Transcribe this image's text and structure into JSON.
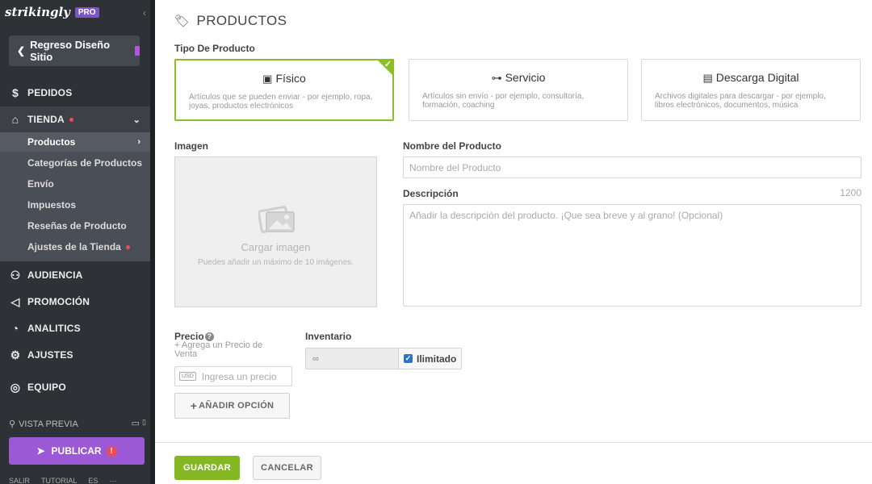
{
  "sidebar": {
    "logo": "strikingly",
    "badge": "PRO",
    "back_label": "Regreso Diseño Sitio",
    "nav": {
      "pedidos": "PEDIDOS",
      "tienda": "TIENDA",
      "audiencia": "AUDIENCIA",
      "promocion": "PROMOCIÓN",
      "analitics": "ANALITICS",
      "ajustes": "AJUSTES",
      "equipo": "EQUIPO"
    },
    "submenu": [
      "Productos",
      "Categorías de Productos",
      "Envío",
      "Impuestos",
      "Reseñas de Producto",
      "Ajustes de la Tienda"
    ],
    "preview_label": "VISTA PREVIA",
    "publish_label": "PUBLICAR",
    "footer_links": [
      "SALIR",
      "TUTORIAL",
      "ES",
      "···"
    ]
  },
  "main": {
    "title": "PRODUCTOS",
    "product_type_label": "Tipo De Producto",
    "product_types": [
      {
        "title": "Físico",
        "description": "Artículos que se pueden enviar - por ejemplo, ropa, joyas, productos electrónicos",
        "selected": true
      },
      {
        "title": "Servicio",
        "description": "Artículos sin envío - por ejemplo, consultoría, formación, coaching",
        "selected": false
      },
      {
        "title": "Descarga Digital",
        "description": "Archivos digitales para descargar - por ejemplo, libros electrónicos, documentos, música",
        "selected": false
      }
    ],
    "image_label": "Imagen",
    "upload_title": "Cargar imagen",
    "upload_subtitle": "Puedes añadir un máximo de 10 imágenes.",
    "name_label": "Nombre del Producto",
    "name_placeholder": "Nombre del Producto",
    "description_label": "Descripción",
    "description_char_limit": "1200",
    "description_placeholder": "Añadir la descripción del producto. ¡Que sea breve y al grano! (Opcional)",
    "price_label": "Precio",
    "add_sale_price": "+ Agrega un Precio de Venta",
    "currency_badge": "USD",
    "price_placeholder": "Ingresa un precio",
    "add_option": "AÑADIR OPCIÓN",
    "inventory_label": "Inventario",
    "inventory_value": "∞",
    "unlimited_label": "Ilimitado",
    "unlimited_checked": true
  },
  "footer": {
    "save": "GUARDAR",
    "cancel": "CANCELAR"
  },
  "colors": {
    "sidebar_bg": "#2e3136",
    "accent_green": "#84b823",
    "publish_purple": "#9b59d6",
    "alert_red": "#ef4a55",
    "checkbox_blue": "#2b74c9"
  }
}
